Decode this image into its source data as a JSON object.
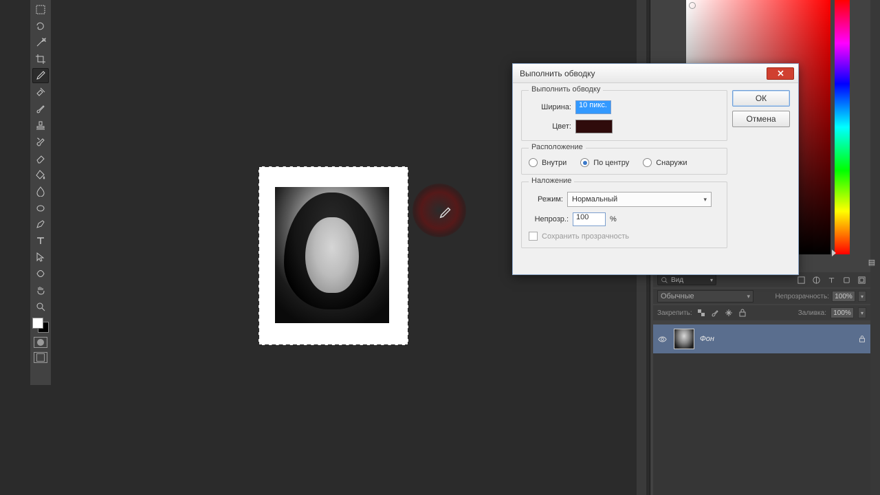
{
  "tools": [
    "rect-select",
    "lasso",
    "magic-wand",
    "crop",
    "eyedropper",
    "patch",
    "brush",
    "stamp",
    "history-brush",
    "eraser",
    "bucket",
    "blur",
    "dodge",
    "pen",
    "type",
    "path-select",
    "shape",
    "hand",
    "zoom"
  ],
  "selected_tool": "eyedropper",
  "dialog": {
    "title": "Выполнить обводку",
    "group_stroke": "Выполнить обводку",
    "width_label": "Ширина:",
    "width_value": "10 пикс.",
    "color_label": "Цвет:",
    "color_hex": "#2f0b0b",
    "group_location": "Расположение",
    "loc_inside": "Внутри",
    "loc_center": "По центру",
    "loc_outside": "Снаружи",
    "loc_selected": "center",
    "group_blend": "Наложение",
    "mode_label": "Режим:",
    "mode_value": "Нормальный",
    "opacity_label": "Непрозр.:",
    "opacity_value": "100",
    "opacity_unit": "%",
    "preserve_label": "Сохранить прозрачность",
    "preserve_checked": false,
    "preserve_enabled": false,
    "btn_ok": "ОК",
    "btn_cancel": "Отмена"
  },
  "layers": {
    "search_label": "Вид",
    "blend_mode": "Обычные",
    "opacity_label": "Непрозрачность:",
    "opacity_value": "100%",
    "lock_label": "Закрепить:",
    "fill_label": "Заливка:",
    "fill_value": "100%",
    "layer_name": "Фон"
  }
}
